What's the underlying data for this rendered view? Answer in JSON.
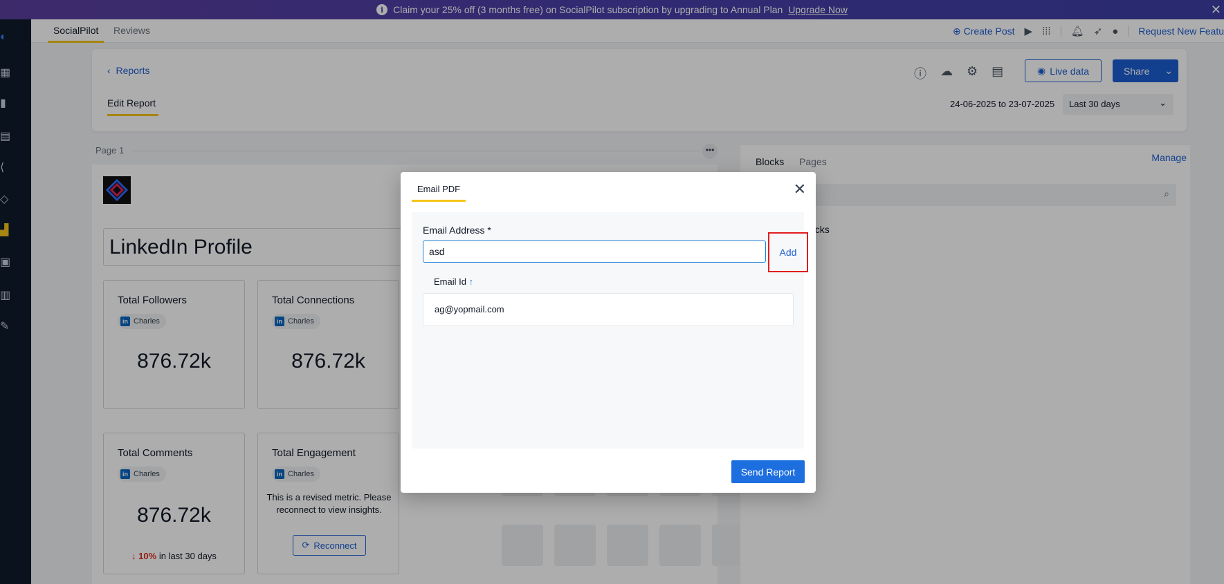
{
  "banner": {
    "text": "Claim your 25% off (3 months free) on SocialPilot subscription by upgrading to Annual Plan",
    "link": "Upgrade Now"
  },
  "topnav": {
    "tabs": [
      {
        "label": "SocialPilot",
        "active": true
      },
      {
        "label": "Reviews",
        "active": false
      }
    ],
    "create_post": "Create Post",
    "request_feature": "Request New Featu"
  },
  "report_header": {
    "back_label": "Reports",
    "edit_tab": "Edit Report",
    "live_data": "Live data",
    "share": "Share",
    "date_range": "24-06-2025 to 23-07-2025",
    "period": "Last 30 days"
  },
  "canvas": {
    "page_label": "Page 1",
    "title": "LinkedIn Profile",
    "metrics": [
      {
        "title": "Total Followers",
        "account": "Charles",
        "value": "876.72k"
      },
      {
        "title": "Total Connections",
        "account": "Charles",
        "value": "876.72k"
      },
      {
        "title": "Total Comments",
        "account": "Charles",
        "value": "876.72k",
        "delta": "10%",
        "delta_suffix": "in last 30 days"
      },
      {
        "title": "Total Engagement",
        "account": "Charles",
        "note": "This is a revised metric. Please reconnect to view insights.",
        "button": "Reconnect"
      }
    ]
  },
  "right_panel": {
    "tabs": [
      "Blocks",
      "Pages"
    ],
    "manage": "Manage",
    "section": "ocks"
  },
  "modal": {
    "title": "Email PDF",
    "email_label": "Email Address *",
    "email_value": "asd",
    "add_label": "Add",
    "column_header": "Email Id",
    "emails": [
      "ag@yopmail.com"
    ],
    "send_label": "Send Report"
  },
  "colors": {
    "accent": "#1d5fd1",
    "tab_underline": "#f5c518",
    "highlight_box": "#e11d1d",
    "linkedin": "#0a66c2"
  }
}
